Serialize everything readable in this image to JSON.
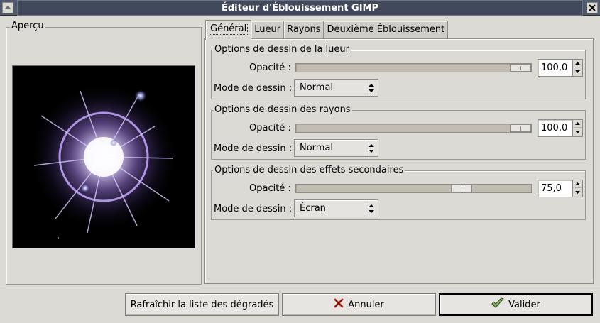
{
  "window": {
    "title": "Éditeur d'Éblouissement GIMP",
    "menu_icon": "gimp-window-menu-icon",
    "close_icon": "close-icon"
  },
  "preview": {
    "label": "Aperçu"
  },
  "tabs": [
    {
      "label": "Général",
      "active": true
    },
    {
      "label": "Lueur",
      "active": false
    },
    {
      "label": "Rayons",
      "active": false
    },
    {
      "label": "Deuxième Éblouissement",
      "active": false
    }
  ],
  "sections": [
    {
      "title": "Options de dessin de la lueur",
      "opacity_label": "Opacité :",
      "opacity_value": "100,0",
      "opacity_fraction": 1.0,
      "mode_label": "Mode de dessin :",
      "mode_value": "Normal"
    },
    {
      "title": "Options de dessin des rayons",
      "opacity_label": "Opacité :",
      "opacity_value": "100,0",
      "opacity_fraction": 1.0,
      "mode_label": "Mode de dessin :",
      "mode_value": "Normal"
    },
    {
      "title": "Options de dessin des effets secondaires",
      "opacity_label": "Opacité :",
      "opacity_value": "75,0",
      "opacity_fraction": 0.75,
      "mode_label": "Mode de dessin :",
      "mode_value": "Écran"
    }
  ],
  "buttons": {
    "refresh": "Rafraîchir la liste des dégradés",
    "cancel": "Annuler",
    "ok": "Valider"
  },
  "colors": {
    "titlebar": "#41495a",
    "window_bg": "#dcdad5",
    "flare_glow": "#b9a0e6"
  }
}
